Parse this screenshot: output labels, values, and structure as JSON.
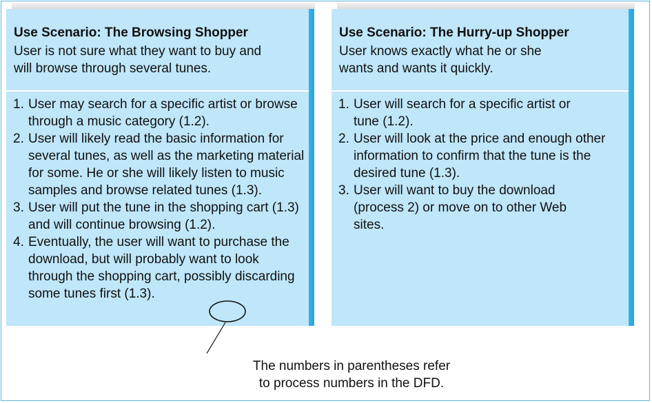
{
  "left_card": {
    "title": "Use Scenario: The Browsing Shopper",
    "description": "User is not sure what they want to buy and will browse through several tunes.",
    "items": [
      {
        "num": "1.",
        "text": "User may search for a specific artist or browse through a music category (1.2)."
      },
      {
        "num": "2.",
        "text": "User will likely read the basic information for several tunes, as well as the marketing material for some. He or she will likely listen to music samples and browse related tunes (1.3)."
      },
      {
        "num": "3.",
        "text": "User will put the tune in the shopping cart (1.3) and will continue browsing (1.2)."
      },
      {
        "num": "4.",
        "text": "Eventually, the user will want to purchase the download, but will probably want to look through the shopping cart, possibly discarding some tunes first (1.3)."
      }
    ]
  },
  "right_card": {
    "title": "Use Scenario: The Hurry-up Shopper",
    "description": "User knows exactly what he or she wants and wants it quickly.",
    "items": [
      {
        "num": "1.",
        "text": "User will search for a specific artist or tune (1.2)."
      },
      {
        "num": "2.",
        "text": "User will look at the price and enough other information to confirm that the tune is the desired tune (1.3)."
      },
      {
        "num": "3.",
        "text": "User will want to buy the download (process 2) or move on to other Web sites."
      }
    ]
  },
  "annotation": {
    "line1": "The numbers in parentheses refer",
    "line2": "to process numbers in the DFD."
  },
  "colors": {
    "card": "#bfe6f9",
    "edge": "#2aa4dc",
    "border": "#5ab4dd"
  }
}
